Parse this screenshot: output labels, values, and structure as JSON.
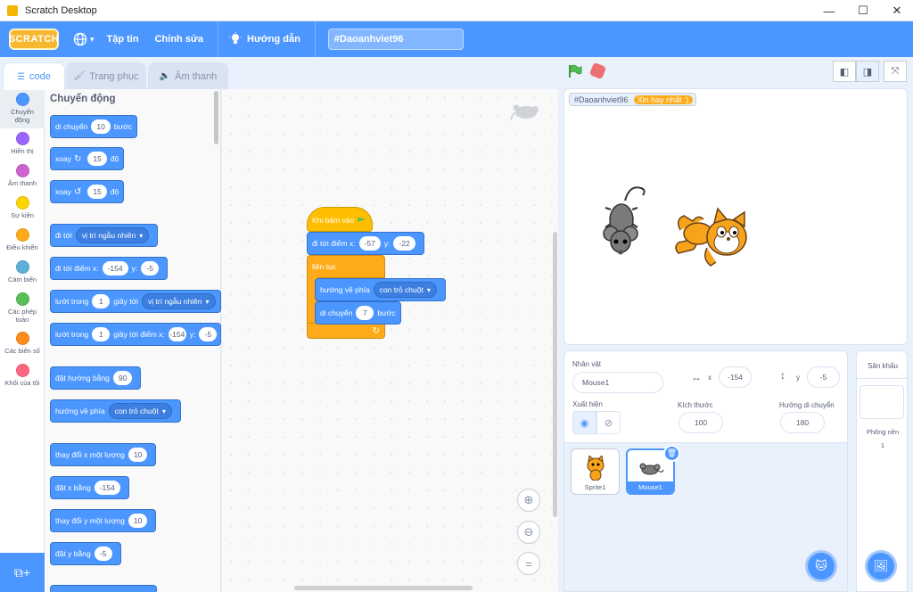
{
  "window": {
    "title": "Scratch Desktop"
  },
  "menubar": {
    "logo": "SCRATCH",
    "file": "Tập tin",
    "edit": "Chỉnh sửa",
    "tutorials": "Hướng dẫn",
    "project_title": "#Daoanhviet96"
  },
  "tabs": {
    "code": "code",
    "costumes": "Trang phục",
    "sounds": "Âm thanh"
  },
  "categories": [
    {
      "label": "Chuyển động",
      "color": "#4c97ff"
    },
    {
      "label": "Hiển thị",
      "color": "#9966ff"
    },
    {
      "label": "Âm thanh",
      "color": "#cf63cf"
    },
    {
      "label": "Sự kiện",
      "color": "#ffd500"
    },
    {
      "label": "Điều khiển",
      "color": "#ffab19"
    },
    {
      "label": "Cảm biến",
      "color": "#5cb1d6"
    },
    {
      "label": "Các phép toán",
      "color": "#59c059"
    },
    {
      "label": "Các biến số",
      "color": "#ff8c1a"
    },
    {
      "label": "Khối của tôi",
      "color": "#ff6680"
    }
  ],
  "palette": {
    "title": "Chuyển động",
    "move": {
      "label": "di chuyển",
      "value": "10",
      "suffix": "bước"
    },
    "turn_right": {
      "label": "xoay",
      "value": "15",
      "suffix": "độ"
    },
    "turn_left": {
      "label": "xoay",
      "value": "15",
      "suffix": "độ"
    },
    "goto": {
      "label": "đi tới",
      "menu": "vị trí ngẫu nhiên"
    },
    "goto_xy": {
      "label": "đi tới điểm x:",
      "x": "-154",
      "ylabel": "y:",
      "y": "-5"
    },
    "glide": {
      "label": "lướt trong",
      "value": "1",
      "mid": "giây tới",
      "menu": "vị trí ngẫu nhiên"
    },
    "glide_xy": {
      "label": "lướt trong",
      "value": "1",
      "mid": "giây tới điểm x:",
      "x": "-154",
      "ylabel": "y:",
      "y": "-5"
    },
    "point_dir": {
      "label": "đặt hướng bằng",
      "value": "90"
    },
    "point_towards": {
      "label": "hướng về phía",
      "menu": "con trỏ chuột"
    },
    "change_x": {
      "label": "thay đổi x một lượng",
      "value": "10"
    },
    "set_x": {
      "label": "đặt x bằng",
      "value": "-154"
    },
    "change_y": {
      "label": "thay đổi y một lượng",
      "value": "10"
    },
    "set_y": {
      "label": "đặt y bằng",
      "value": "-5"
    }
  },
  "script": {
    "hat": "Khi bấm vào",
    "goto_xy": {
      "label": "đi tới điểm x:",
      "x": "-57",
      "ylabel": "y:",
      "y": "-22"
    },
    "forever": "liên tục",
    "point_towards": {
      "label": "hướng về phía",
      "menu": "con trỏ chuột"
    },
    "move": {
      "label": "di chuyển",
      "value": "7",
      "suffix": "bước"
    }
  },
  "stage": {
    "variable_name": "#Daoanhviet96",
    "variable_value": "Xin hay nhất :)"
  },
  "sprite_info": {
    "sprite_label": "Nhân vật",
    "sprite_name": "Mouse1",
    "x_label": "x",
    "x_value": "-154",
    "y_label": "y",
    "y_value": "-5",
    "show_label": "Xuất hiện",
    "size_label": "Kích thước",
    "size_value": "100",
    "direction_label": "Hướng di chuyển",
    "direction_value": "180"
  },
  "sprites": [
    {
      "name": "Sprite1",
      "selected": false
    },
    {
      "name": "Mouse1",
      "selected": true
    }
  ],
  "stage_panel": {
    "title": "Sân khấu",
    "backdrops_label": "Phông nền",
    "backdrops_count": "1"
  },
  "colors": {
    "motion": "#4c97ff",
    "control": "#ffab19",
    "events": "#ffbf00",
    "accent": "#4c97ff"
  }
}
